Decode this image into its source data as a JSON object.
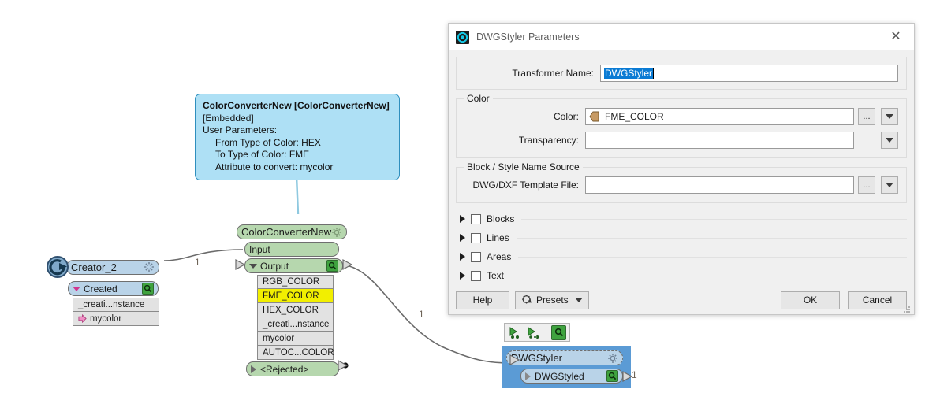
{
  "canvas": {
    "annotation": {
      "title": "ColorConverterNew [ColorConverterNew]",
      "line2": "[Embedded]",
      "line3": "User Parameters:",
      "param1": "From Type of Color: HEX",
      "param2": "To Type of Color: FME",
      "param3": "Attribute to convert: mycolor",
      "bg_color": "#aee0f5",
      "border_color": "#2f8fbe"
    },
    "creator_node": {
      "title": "Creator_2",
      "icon": "creator-circle-arrow-icon",
      "gear_icon": "gear-icon",
      "output_port": "Created",
      "port_magnifier_icon": "magnifier-icon",
      "attributes": [
        "_creati...nstance",
        "mycolor"
      ],
      "attr_icon": "pink-arrow-icon",
      "header_color": "#b9d3e8"
    },
    "converter_node": {
      "title": "ColorConverterNew",
      "gear_icon": "gear-icon",
      "input_port": "Input",
      "output_port": "Output",
      "output_magnifier_icon": "magnifier-icon",
      "attributes": [
        "RGB_COLOR",
        "FME_COLOR",
        "HEX_COLOR",
        "_creati...nstance",
        "mycolor",
        "AUTOC...COLOR"
      ],
      "highlighted_attribute": "FME_COLOR",
      "highlight_color": "#f2ef00",
      "rejected_port": "<Rejected>",
      "node_color": "#b6d7ae"
    },
    "dwgstyler_node": {
      "title": "DWGStyler",
      "gear_icon": "gear-icon",
      "output_port": "DWGStyled",
      "port_magnifier_icon": "magnifier-icon",
      "selected": true,
      "selection_color": "#5b9bd5"
    },
    "mini_toolbar": {
      "buttons": [
        "add-bookmark-icon",
        "connect-icon",
        "inspect-magnifier-icon"
      ]
    },
    "wire_labels": [
      "1",
      "1",
      "1"
    ]
  },
  "dialog": {
    "title": "DWGStyler Parameters",
    "title_icon": "transformer-circle-icon",
    "close_icon": "close-icon",
    "transformer_name": {
      "label": "Transformer Name:",
      "value": "DWGStyler",
      "selected": true
    },
    "color_section": {
      "legend": "Color",
      "color": {
        "label": "Color:",
        "value": "FME_COLOR",
        "attr_icon": "fme-attribute-icon",
        "browse_label": "...",
        "dropdown_icon": "chevron-down-icon"
      },
      "transparency": {
        "label": "Transparency:",
        "value": "",
        "dropdown_icon": "chevron-down-icon"
      }
    },
    "block_style_section": {
      "legend": "Block / Style Name Source",
      "template_file": {
        "label": "DWG/DXF Template File:",
        "value": "",
        "browse_label": "...",
        "dropdown_icon": "chevron-down-icon"
      }
    },
    "collapsibles": [
      {
        "label": "Blocks",
        "expanded": false,
        "checked": false
      },
      {
        "label": "Lines",
        "expanded": false,
        "checked": false
      },
      {
        "label": "Areas",
        "expanded": false,
        "checked": false
      },
      {
        "label": "Text",
        "expanded": false,
        "checked": false
      }
    ],
    "buttons": {
      "help": "Help",
      "presets": "Presets",
      "presets_icon": "presets-gear-icon",
      "ok": "OK",
      "cancel": "Cancel"
    }
  }
}
